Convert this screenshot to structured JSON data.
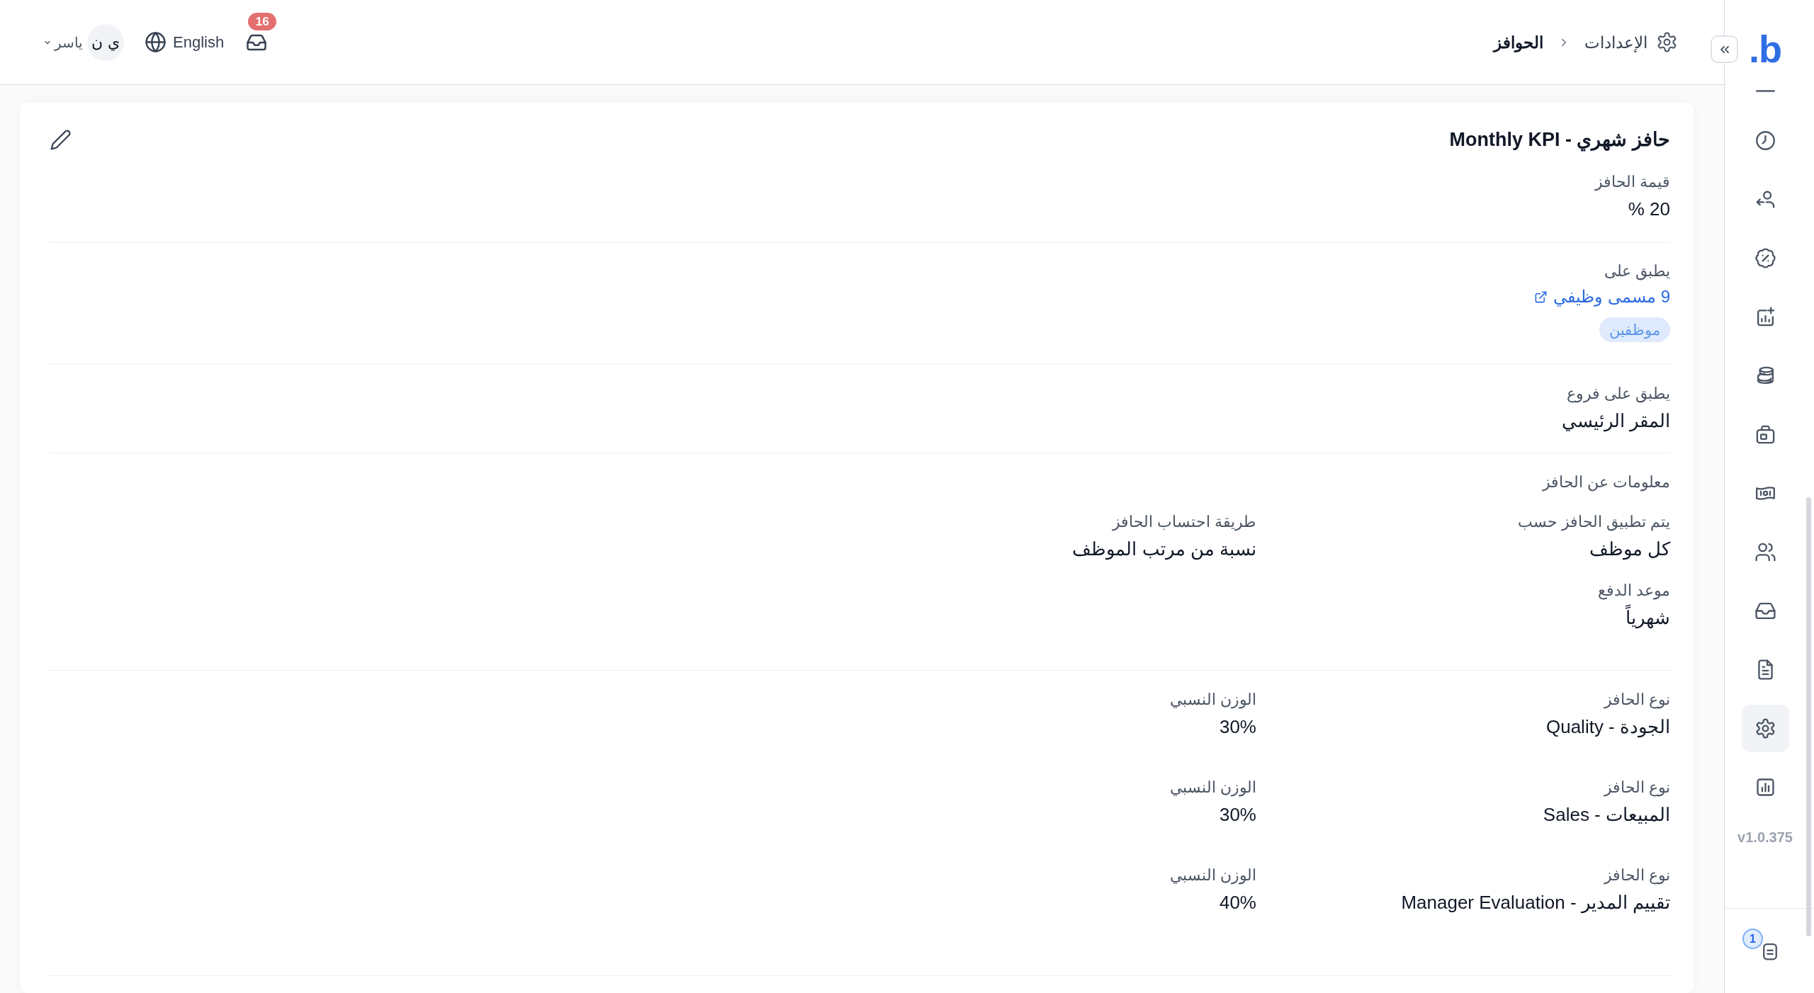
{
  "sidebar": {
    "logo": "b.",
    "nav_items": [
      {
        "selected": false
      },
      {
        "selected": false
      },
      {
        "selected": false
      },
      {
        "selected": false
      },
      {
        "selected": false
      },
      {
        "selected": false
      },
      {
        "selected": false
      },
      {
        "selected": false
      },
      {
        "selected": false
      },
      {
        "selected": false
      },
      {
        "selected": true
      },
      {
        "selected": false
      }
    ],
    "version": "v1.0.375",
    "footer_item": {
      "badge": "1"
    }
  },
  "header": {
    "breadcrumb": [
      {
        "label": "الإعدادات",
        "current": false
      },
      {
        "label": "الحوافز",
        "current": true
      }
    ],
    "notifications_badge": "16",
    "language": "English",
    "user": {
      "initials": "ي ن",
      "name": "ياسر"
    }
  },
  "incentive": {
    "title": "حافز شهري - Monthly KPI",
    "amount": {
      "label": "قيمة الحافز",
      "value": "20 %"
    },
    "applies_to": {
      "label": "يطبق على",
      "link": "9 مسمى وظيفي",
      "tag": "موظفين"
    },
    "branches": {
      "label": "يطبق على فروع",
      "value": "المقر الرئيسي"
    },
    "info": {
      "heading": "معلومات عن الحافز",
      "fields": [
        {
          "label": "يتم تطبيق الحافز حسب",
          "value": "كل موظف"
        },
        {
          "label": "طريقة احتساب الحافز",
          "value": "نسبة من مرتب الموظف"
        },
        {
          "label": "موعد الدفع",
          "value": "شهرياً"
        }
      ]
    },
    "types": [
      {
        "type_label": "نوع الحافز",
        "type": "الجودة - Quality",
        "weight_label": "الوزن النسبي",
        "weight": "30%"
      },
      {
        "type_label": "نوع الحافز",
        "type": "المبيعات - Sales",
        "weight_label": "الوزن النسبي",
        "weight": "30%"
      },
      {
        "type_label": "نوع الحافز",
        "type": "تقييم المدير - Manager Evaluation",
        "weight_label": "الوزن النسبي",
        "weight": "40%"
      }
    ]
  }
}
